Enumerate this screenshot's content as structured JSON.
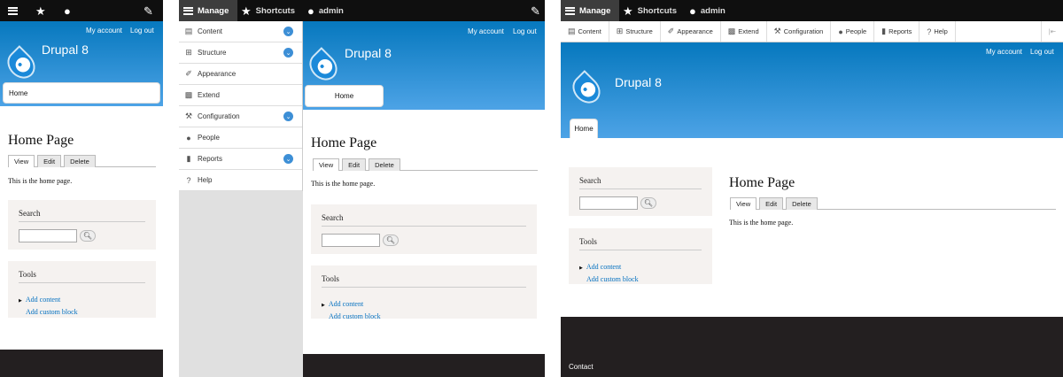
{
  "toolbar": {
    "manage": "Manage",
    "shortcuts": "Shortcuts",
    "user": "admin",
    "icons": {
      "menu": "hamburger-icon",
      "star": "star-icon",
      "person": "person-icon",
      "pencil": "pencil-icon"
    }
  },
  "secondary": {
    "my_account": "My account",
    "log_out": "Log out"
  },
  "site_name": "Drupal 8",
  "primary_nav": {
    "home": "Home"
  },
  "page": {
    "title": "Home Page",
    "tabs": [
      "View",
      "Edit",
      "Delete"
    ],
    "body": "This is the home page."
  },
  "search_block": {
    "title": "Search",
    "button_icon": "magnifier-icon"
  },
  "tools_block": {
    "title": "Tools",
    "links": [
      "Add content",
      "Add custom block"
    ]
  },
  "admin_menu": [
    {
      "label": "Content",
      "icon": "file-icon",
      "expandable": true
    },
    {
      "label": "Structure",
      "icon": "sitemap-icon",
      "expandable": true
    },
    {
      "label": "Appearance",
      "icon": "brush-icon",
      "expandable": false
    },
    {
      "label": "Extend",
      "icon": "puzzle-icon",
      "expandable": false
    },
    {
      "label": "Configuration",
      "icon": "wrench-icon",
      "expandable": true
    },
    {
      "label": "People",
      "icon": "people-icon",
      "expandable": false
    },
    {
      "label": "Reports",
      "icon": "bar-chart-icon",
      "expandable": true
    },
    {
      "label": "Help",
      "icon": "help-icon",
      "expandable": false
    }
  ],
  "footer": {
    "contact": "Contact"
  },
  "colors": {
    "toolbar": "#0f0f0f",
    "brand_blue": "#0678be",
    "link": "#0571c0",
    "footer": "#231f20",
    "sidebar_block": "#f5f2f0"
  }
}
